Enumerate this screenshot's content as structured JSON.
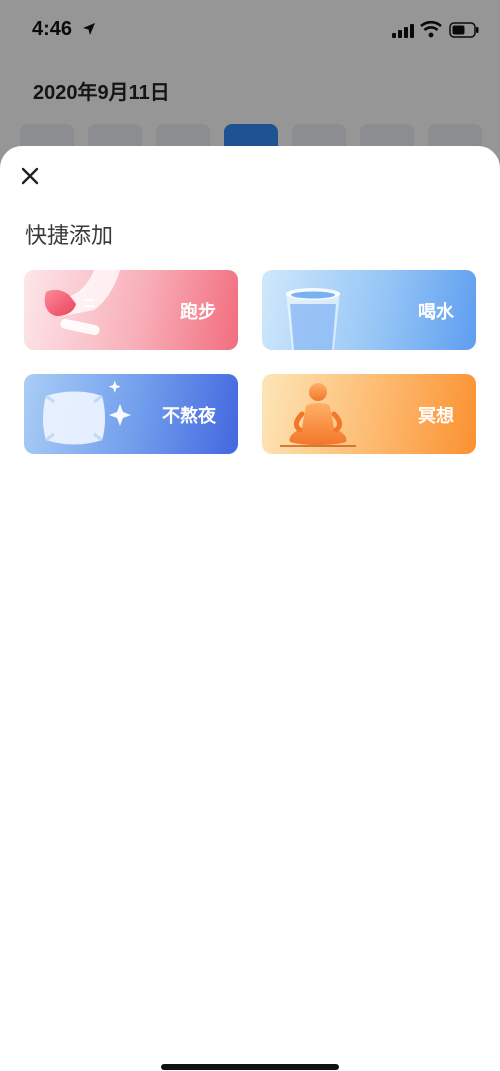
{
  "status_bar": {
    "time": "4:46",
    "icons": [
      "location-arrow-icon",
      "signal-icon",
      "wifi-icon",
      "battery-icon"
    ]
  },
  "background": {
    "date_title": "2020年9月11日",
    "week_days_count": 7,
    "active_day_index": 3
  },
  "sheet": {
    "close_icon": "close-icon",
    "title": "快捷添加",
    "cards": [
      {
        "label": "跑步",
        "icon": "running-shoe-icon",
        "color": "#f26d7e"
      },
      {
        "label": "喝水",
        "icon": "water-glass-icon",
        "color": "#5e9ef0"
      },
      {
        "label": "不熬夜",
        "icon": "pillow-icon",
        "color": "#4467e0"
      },
      {
        "label": "冥想",
        "icon": "meditation-icon",
        "color": "#fb9131"
      }
    ]
  },
  "colors": {
    "accent_blue": "#2f86e8",
    "overlay": "rgba(0,0,0,0.38)"
  }
}
